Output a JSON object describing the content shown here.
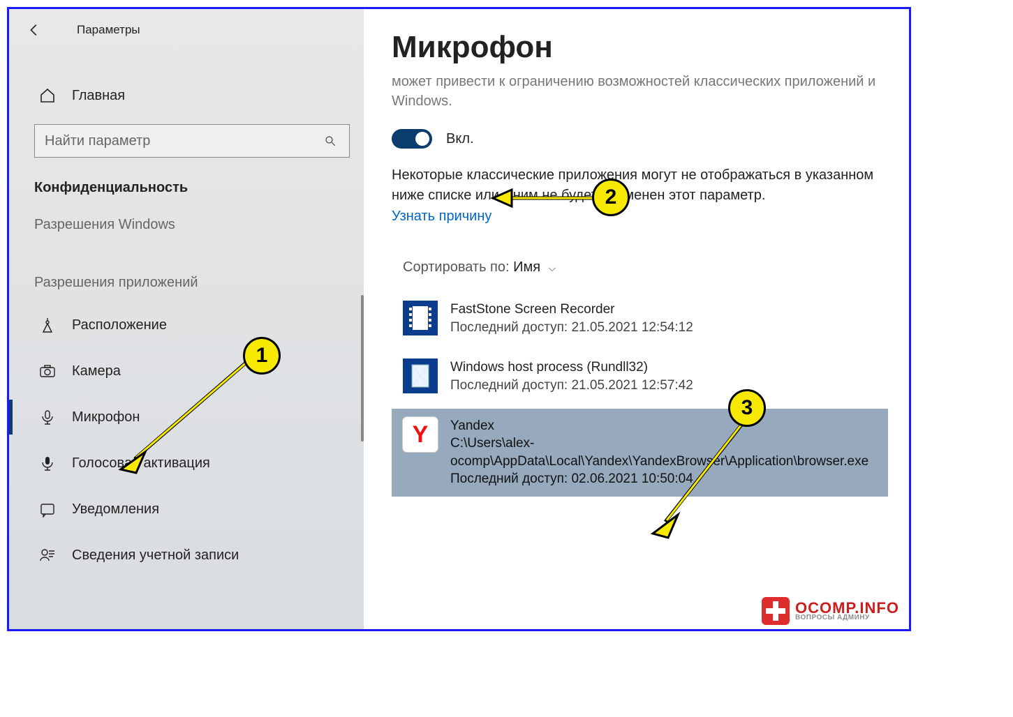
{
  "app_title": "Параметры",
  "home_label": "Главная",
  "search_placeholder": "Найти параметр",
  "sidebar_section_title": "Конфиденциальность",
  "sidebar_group_windows": "Разрешения Windows",
  "sidebar_group_apps": "Разрешения приложений",
  "sidebar_items": [
    {
      "label": "Расположение",
      "icon": "location"
    },
    {
      "label": "Камера",
      "icon": "camera"
    },
    {
      "label": "Микрофон",
      "icon": "microphone",
      "selected": true
    },
    {
      "label": "Голосовая активация",
      "icon": "voice"
    },
    {
      "label": "Уведомления",
      "icon": "notification"
    },
    {
      "label": "Сведения учетной записи",
      "icon": "account"
    }
  ],
  "page_title": "Микрофон",
  "desc_partial": "может привести к ограничению возможностей классических приложений и Windows.",
  "toggle_label": "Вкл.",
  "note_text": "Некоторые классические приложения могут не отображаться в указанном ниже списке или к ним не будет применен этот параметр.",
  "link_text": "Узнать причину",
  "sort_label": "Сортировать по:",
  "sort_value": "Имя",
  "apps": [
    {
      "name": "FastStone Screen Recorder",
      "last_access": "Последний доступ: 21.05.2021 12:54:12",
      "icon": "film"
    },
    {
      "name": "Windows host process (Rundll32)",
      "last_access": "Последний доступ: 21.05.2021 12:57:42",
      "icon": "file"
    },
    {
      "name": "Yandex",
      "path": "C:\\Users\\alex-ocomp\\AppData\\Local\\Yandex\\YandexBrowser\\Application\\browser.exe",
      "last_access": "Последний доступ: 02.06.2021 10:50:04",
      "icon": "yandex",
      "selected": true
    }
  ],
  "annotations": {
    "badge1": "1",
    "badge2": "2",
    "badge3": "3"
  },
  "watermark": {
    "main": "OCOMP.INFO",
    "sub": "ВОПРОСЫ АДМИНУ"
  }
}
